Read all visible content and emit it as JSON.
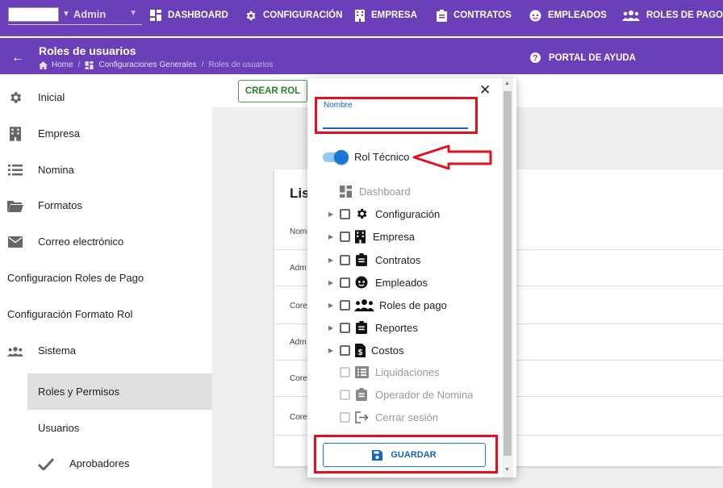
{
  "topnav": {
    "user_name": "Admin",
    "items": [
      {
        "label": "DASHBOARD",
        "icon": "dashboard-icon"
      },
      {
        "label": "CONFIGURACIÓN",
        "icon": "gear-icon"
      },
      {
        "label": "EMPRESA",
        "icon": "building-icon"
      },
      {
        "label": "CONTRATOS",
        "icon": "clipboard-icon"
      },
      {
        "label": "EMPLEADOS",
        "icon": "face-icon"
      },
      {
        "label": "ROLES DE PAGO",
        "icon": "people-icon"
      }
    ]
  },
  "header": {
    "title": "Roles de usuarios",
    "breadcrumb": [
      "Home",
      "Configuraciones Generales",
      "Roles de usuarios"
    ],
    "help_label": "PORTAL DE AYUDA"
  },
  "sidebar": {
    "items": [
      {
        "label": "Inicial",
        "icon": "gear-icon"
      },
      {
        "label": "Empresa",
        "icon": "building-icon"
      },
      {
        "label": "Nomina",
        "icon": "list-icon"
      },
      {
        "label": "Formatos",
        "icon": "folder-icon"
      },
      {
        "label": "Correo electrónico",
        "icon": "mail-icon"
      },
      {
        "label": "Configuracion Roles de Pago"
      },
      {
        "label": "Configuración Formato Rol"
      },
      {
        "label": "Sistema",
        "icon": "people-icon"
      },
      {
        "label": "Roles y Permisos"
      },
      {
        "label": "Usuarios"
      },
      {
        "label": "Aprobadores",
        "icon": "check-icon"
      }
    ]
  },
  "main": {
    "create_button": "CREAR ROL",
    "card_title": "Lis",
    "rows": [
      "Nomb",
      "Adm",
      "Core",
      "Adm",
      "Core",
      "Core"
    ]
  },
  "modal": {
    "name_label": "Nombre",
    "name_value": "",
    "toggle_label": "Rol Técnico",
    "toggle_on": true,
    "tree": [
      {
        "label": "Dashboard",
        "icon": "dashboard-icon",
        "disabled": true,
        "expandable": false,
        "checkbox": false
      },
      {
        "label": "Configuración",
        "icon": "gear-icon",
        "disabled": false,
        "expandable": true,
        "checkbox": true
      },
      {
        "label": "Empresa",
        "icon": "building-icon",
        "disabled": false,
        "expandable": true,
        "checkbox": true
      },
      {
        "label": "Contratos",
        "icon": "clipboard-icon",
        "disabled": false,
        "expandable": true,
        "checkbox": true
      },
      {
        "label": "Empleados",
        "icon": "face-icon",
        "disabled": false,
        "expandable": true,
        "checkbox": true
      },
      {
        "label": "Roles de pago",
        "icon": "people-icon",
        "disabled": false,
        "expandable": true,
        "checkbox": true
      },
      {
        "label": "Reportes",
        "icon": "clipboard-icon",
        "disabled": false,
        "expandable": true,
        "checkbox": true
      },
      {
        "label": "Costos",
        "icon": "dollar-file-icon",
        "disabled": false,
        "expandable": true,
        "checkbox": true
      },
      {
        "label": "Liquidaciones",
        "icon": "list-alt-icon",
        "disabled": true,
        "expandable": false,
        "checkbox": true
      },
      {
        "label": "Operador de Nomina",
        "icon": "clipboard-icon",
        "disabled": true,
        "expandable": false,
        "checkbox": true
      },
      {
        "label": "Cerrar sesión",
        "icon": "logout-icon",
        "disabled": true,
        "expandable": false,
        "checkbox": true
      }
    ],
    "save_label": "GUARDAR"
  },
  "colors": {
    "primary": "#6a3fb8",
    "accent": "#1976d2",
    "annotation": "#e3101d",
    "create": "#2e7d32"
  }
}
